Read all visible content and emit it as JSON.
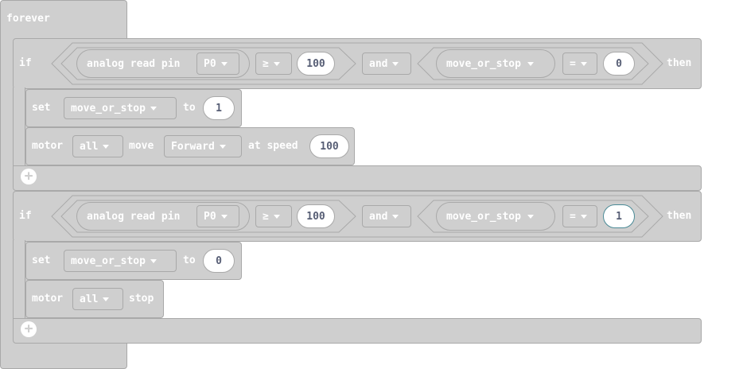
{
  "forever_label": "forever",
  "if1": {
    "if_label": "if",
    "then_label": "then",
    "left": {
      "read_label": "analog read pin",
      "pin": "P0",
      "op": "≥",
      "value": "100"
    },
    "and_label": "and",
    "right": {
      "variable": "move_or_stop",
      "op": "=",
      "value": "0"
    },
    "set_label": "set",
    "set_var": "move_or_stop",
    "to_label": "to",
    "set_value": "1",
    "motor_label": "motor",
    "motor_sel": "all",
    "move_label": "move",
    "direction": "Forward",
    "at_speed_label": "at speed",
    "speed": "100"
  },
  "if2": {
    "if_label": "if",
    "then_label": "then",
    "left": {
      "read_label": "analog read pin",
      "pin": "P0",
      "op": "≥",
      "value": "100"
    },
    "and_label": "and",
    "right": {
      "variable": "move_or_stop",
      "op": "=",
      "value": "1"
    },
    "set_label": "set",
    "set_var": "move_or_stop",
    "to_label": "to",
    "set_value": "0",
    "motor_label": "motor",
    "motor_sel": "all",
    "stop_label": "stop"
  },
  "colors": {
    "block": "#cfcfcf",
    "border": "#a9a9a9",
    "text": "#ffffff",
    "number_text": "#575e75",
    "focus": "#4a8a96"
  },
  "icons": [
    "caret-down-icon",
    "add-icon"
  ]
}
